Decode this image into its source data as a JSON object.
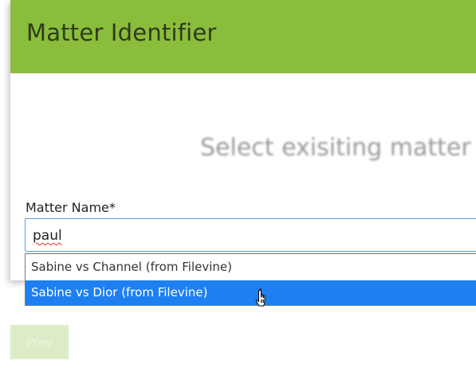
{
  "header": {
    "title": "Matter Identifier"
  },
  "main": {
    "subtitle": "Select exisiting matter o"
  },
  "form": {
    "matter_name_label": "Matter Name*",
    "matter_name_value": "paul"
  },
  "dropdown": {
    "options": [
      {
        "label": "Sabine vs Channel (from Filevine)",
        "selected": false
      },
      {
        "label": "Sabine vs Dior (from Filevine)",
        "selected": true
      }
    ]
  },
  "footer": {
    "prev_label": "Prev"
  },
  "colors": {
    "header_bg": "#8bbd3c",
    "selected_option_bg": "#1e7ff0",
    "input_border": "#5b9be6",
    "prev_button_bg": "#dcecc6"
  },
  "icons": {
    "cursor": "hand-pointer-cursor-icon"
  }
}
